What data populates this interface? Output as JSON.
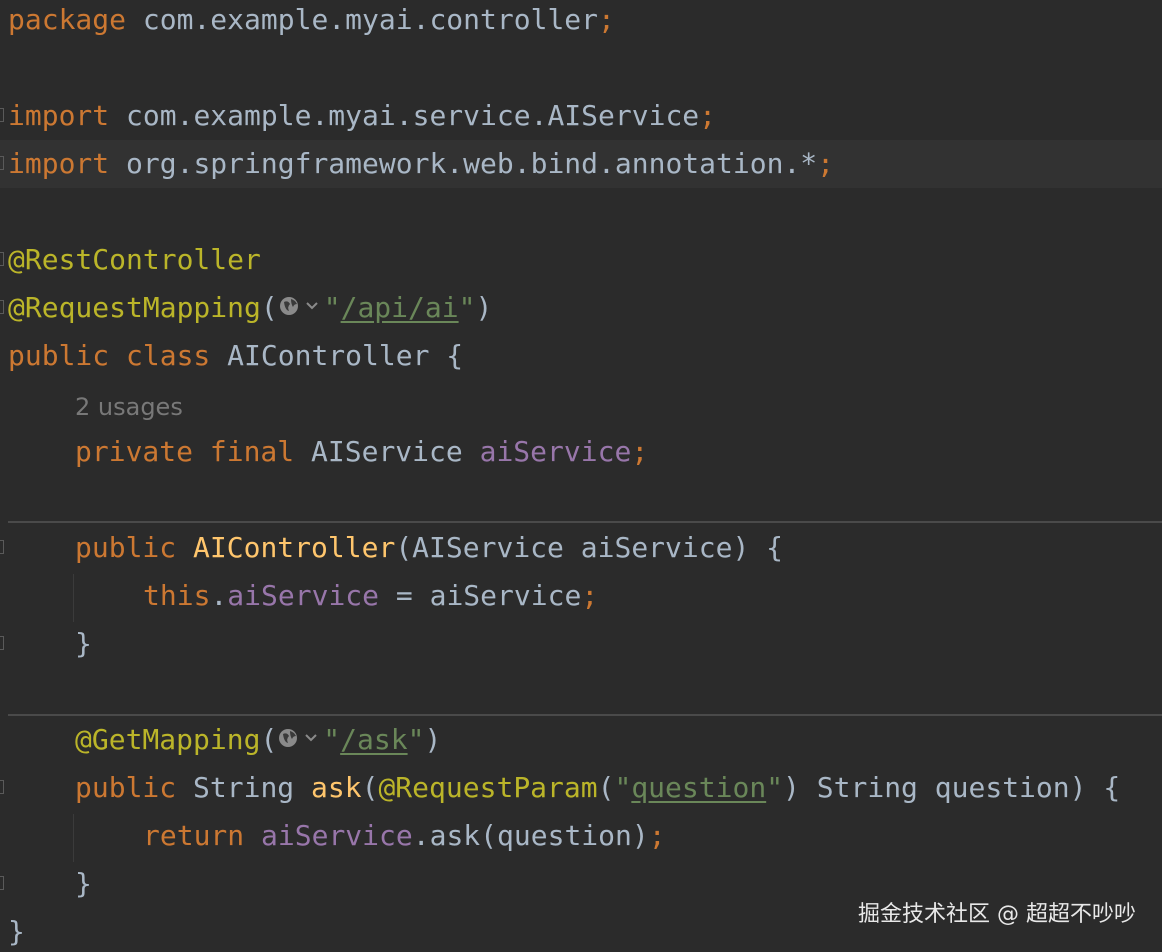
{
  "editor": {
    "theme_colors": {
      "background": "#2b2b2b",
      "keyword": "#cc7832",
      "annotation": "#bbb529",
      "string": "#6a8759",
      "field": "#9876aa",
      "method": "#ffc66d",
      "plain": "#a9b7c6",
      "hint": "#787878"
    },
    "lines": {
      "l1": {
        "kw": "package",
        "rest": " com.example.myai.controller",
        "semi": ";"
      },
      "l3": {
        "kw": "import",
        "rest": " com.example.myai.service.AIService",
        "semi": ";"
      },
      "l4": {
        "kw": "import",
        "rest": " org.springframework.web.bind.annotation.*",
        "semi": ";"
      },
      "l6": {
        "ann": "@RestController"
      },
      "l7": {
        "ann": "@RequestMapping",
        "open": "(",
        "q1": "\"",
        "url": "/api/ai",
        "q2": "\"",
        "close": ")"
      },
      "l8": {
        "kw": "public class",
        "rest": " AIController {"
      },
      "hint": "2 usages",
      "l9": {
        "kw": "private final",
        "type": " AIService ",
        "field": "aiService",
        "semi": ";"
      },
      "l11": {
        "kw": "public",
        "fn": " AIController",
        "rest": "(AIService aiService) {"
      },
      "l12": {
        "kw": "this",
        "dot": ".",
        "field": "aiService",
        "rest": " = aiService",
        "semi": ";"
      },
      "l13": "}",
      "l15": {
        "ann": "@GetMapping",
        "open": "(",
        "q1": "\"",
        "url": "/ask",
        "q2": "\"",
        "close": ")"
      },
      "l16": {
        "kw": "public",
        "type": " String ",
        "fn": "ask",
        "open": "(",
        "ann": "@RequestParam",
        "paren": "(",
        "q1": "\"",
        "url": "question",
        "q2": "\"",
        "rest": ") String question) {"
      },
      "l17": {
        "kw": "return",
        "field": " aiService",
        "rest": ".ask(question)",
        "semi": ";"
      },
      "l18": "}",
      "l19": "}"
    },
    "inlay_icon": "globe-icon",
    "inlay_chevron": "chevron-down-icon"
  },
  "watermark": "掘金技术社区 @ 超超不吵吵"
}
